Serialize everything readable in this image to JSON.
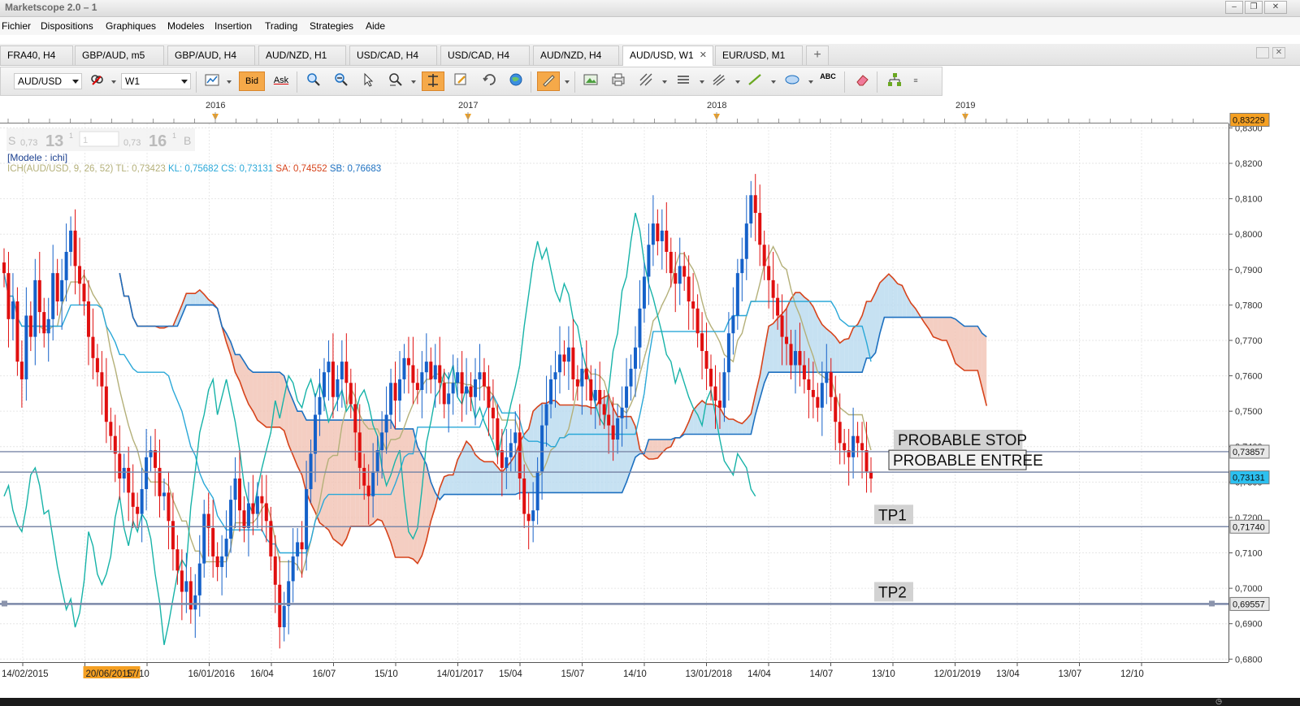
{
  "window": {
    "title": "Marketscope 2.0 – 1"
  },
  "menu": [
    "Fichier",
    "Dispositions",
    "Graphiques",
    "Modeles",
    "Insertion",
    "Trading",
    "Strategies",
    "Aide"
  ],
  "tabs": [
    {
      "label": "FRA40, H4",
      "active": false
    },
    {
      "label": "GBP/AUD, m5",
      "active": false
    },
    {
      "label": "GBP/AUD, H4",
      "active": false
    },
    {
      "label": "AUD/NZD, H1",
      "active": false
    },
    {
      "label": "USD/CAD, H4",
      "active": false
    },
    {
      "label": "USD/CAD, H4",
      "active": false
    },
    {
      "label": "AUD/NZD, H4",
      "active": false
    },
    {
      "label": "AUD/USD, W1",
      "active": true
    },
    {
      "label": "EUR/USD, M1",
      "active": false
    }
  ],
  "toolbar": {
    "symbol": "AUD/USD",
    "timeframe": "W1",
    "bid_label": "Bid",
    "ask_label": "Ask",
    "abc_label": "ABC"
  },
  "quote": {
    "sell_label": "S",
    "sell_big": "0,73",
    "sell_pips": "13",
    "sell_frac": "1",
    "amount": "1",
    "buy_big": "0,73",
    "buy_pips": "16",
    "buy_frac": "1",
    "buy_label": "B"
  },
  "model_label": "[Modele : ichi]",
  "indicator_legend": [
    {
      "text": "ICH(AUD/USD, 9, 26, 52)",
      "color": "#b4b079"
    },
    {
      "text": "TL: 0,73423",
      "color": "#b4b079"
    },
    {
      "text": "KL: 0,75682",
      "color": "#2aa8d8"
    },
    {
      "text": "CS: 0,73131",
      "color": "#2aa8d8"
    },
    {
      "text": "SA: 0,74552",
      "color": "#d6431b"
    },
    {
      "text": "SB: 0,76683",
      "color": "#1d70c0"
    }
  ],
  "top_years": [
    "2016",
    "2017",
    "2018",
    "2019"
  ],
  "chart_data": {
    "type": "candlestick",
    "symbol": "AUD/USD",
    "timeframe": "W1",
    "y_ticks": [
      "0,8300",
      "0,8200",
      "0,8100",
      "0,8000",
      "0,7900",
      "0,7800",
      "0,7700",
      "0,7600",
      "0,7500",
      "0,7400",
      "0,7300",
      "0,7200",
      "0,7100",
      "0,7000",
      "0,6900",
      "0,6800"
    ],
    "ylim": [
      0.678,
      0.834
    ],
    "x_ticks": [
      "14/02/2015",
      "20/06/2015",
      "17/10",
      "16/01/2016",
      "16/04",
      "16/07",
      "15/10",
      "14/01/2017",
      "15/04",
      "15/07",
      "14/10",
      "13/01/2018",
      "14/04",
      "14/07",
      "13/10",
      "12/01/2019",
      "13/04",
      "13/07",
      "12/10"
    ],
    "x_highlight": "20/06/2015",
    "price_badges": [
      {
        "label": "0,83229",
        "value": 0.83229,
        "color": "#f5a022"
      },
      {
        "label": "0,73857",
        "value": 0.73857,
        "color": "#e8e8e8"
      },
      {
        "label": "0,73131",
        "value": 0.73131,
        "color": "#2cc0f0"
      },
      {
        "label": "0,71740",
        "value": 0.7174,
        "color": "#e8e8e8"
      },
      {
        "label": "0,69557",
        "value": 0.69557,
        "color": "#e8e8e8"
      }
    ],
    "horizontal_levels": [
      {
        "label": "PROBABLE  STOP",
        "value": 0.73857
      },
      {
        "label": "PROBABLE ENTREE",
        "value": 0.7328
      },
      {
        "label": "TP1",
        "value": 0.7174
      },
      {
        "label": "TP2",
        "value": 0.69557
      }
    ],
    "close": [
      0.789,
      0.776,
      0.781,
      0.764,
      0.759,
      0.777,
      0.771,
      0.787,
      0.778,
      0.772,
      0.776,
      0.789,
      0.781,
      0.787,
      0.795,
      0.801,
      0.791,
      0.786,
      0.781,
      0.771,
      0.765,
      0.761,
      0.757,
      0.747,
      0.743,
      0.738,
      0.731,
      0.734,
      0.727,
      0.723,
      0.721,
      0.728,
      0.737,
      0.739,
      0.734,
      0.726,
      0.727,
      0.719,
      0.711,
      0.705,
      0.699,
      0.702,
      0.694,
      0.698,
      0.707,
      0.721,
      0.717,
      0.709,
      0.706,
      0.709,
      0.714,
      0.725,
      0.731,
      0.722,
      0.717,
      0.724,
      0.721,
      0.726,
      0.724,
      0.719,
      0.709,
      0.701,
      0.689,
      0.695,
      0.702,
      0.709,
      0.713,
      0.711,
      0.728,
      0.738,
      0.749,
      0.754,
      0.761,
      0.764,
      0.754,
      0.759,
      0.764,
      0.758,
      0.752,
      0.744,
      0.734,
      0.729,
      0.726,
      0.733,
      0.739,
      0.744,
      0.749,
      0.758,
      0.753,
      0.759,
      0.765,
      0.763,
      0.758,
      0.756,
      0.761,
      0.764,
      0.759,
      0.763,
      0.758,
      0.752,
      0.755,
      0.758,
      0.761,
      0.755,
      0.757,
      0.754,
      0.759,
      0.761,
      0.757,
      0.751,
      0.748,
      0.739,
      0.734,
      0.737,
      0.741,
      0.744,
      0.731,
      0.721,
      0.719,
      0.722,
      0.733,
      0.746,
      0.752,
      0.759,
      0.761,
      0.766,
      0.764,
      0.768,
      0.759,
      0.757,
      0.762,
      0.759,
      0.753,
      0.756,
      0.752,
      0.749,
      0.746,
      0.742,
      0.748,
      0.751,
      0.757,
      0.762,
      0.768,
      0.779,
      0.788,
      0.797,
      0.803,
      0.798,
      0.801,
      0.795,
      0.789,
      0.786,
      0.791,
      0.788,
      0.781,
      0.779,
      0.772,
      0.767,
      0.762,
      0.757,
      0.753,
      0.751,
      0.761,
      0.772,
      0.777,
      0.789,
      0.793,
      0.803,
      0.811,
      0.806,
      0.797,
      0.791,
      0.787,
      0.782,
      0.777,
      0.771,
      0.769,
      0.763,
      0.767,
      0.763,
      0.759,
      0.756,
      0.754,
      0.751,
      0.758,
      0.761,
      0.754,
      0.747,
      0.741,
      0.739,
      0.737,
      0.743,
      0.741,
      0.739,
      0.733,
      0.731
    ],
    "note": "closes are weekly values estimated from the price axis"
  }
}
